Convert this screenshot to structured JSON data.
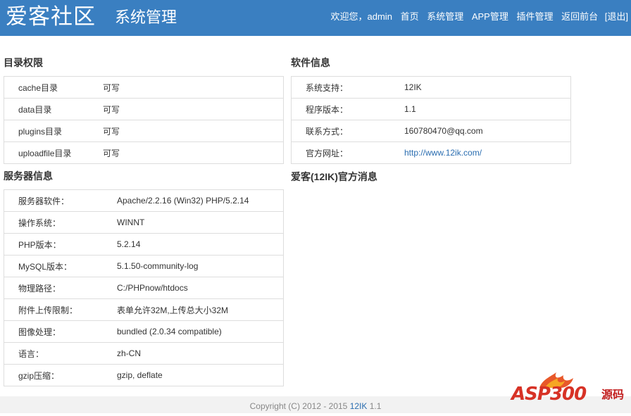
{
  "header": {
    "brand": "爱客社区",
    "subtitle": "系统管理",
    "welcome": "欢迎您，admin",
    "nav": [
      "首页",
      "系统管理",
      "APP管理",
      "插件管理",
      "返回前台",
      "[退出]"
    ]
  },
  "dir_perms": {
    "title": "目录权限",
    "rows": [
      {
        "k": "cache目录",
        "v": "可写"
      },
      {
        "k": "data目录",
        "v": "可写"
      },
      {
        "k": "plugins目录",
        "v": "可写"
      },
      {
        "k": "uploadfile目录",
        "v": "可写"
      }
    ]
  },
  "software": {
    "title": "软件信息",
    "rows": [
      {
        "k": "系统支持：",
        "v": "12IK"
      },
      {
        "k": "程序版本：",
        "v": "1.1"
      },
      {
        "k": "联系方式：",
        "v": "160780470@qq.com"
      },
      {
        "k": "官方网址：",
        "v": "http://www.12ik.com/"
      }
    ]
  },
  "server": {
    "title": "服务器信息",
    "rows": [
      {
        "k": "服务器软件：",
        "v": "Apache/2.2.16 (Win32) PHP/5.2.14"
      },
      {
        "k": "操作系统：",
        "v": "WINNT"
      },
      {
        "k": "PHP版本：",
        "v": "5.2.14"
      },
      {
        "k": "MySQL版本：",
        "v": "5.1.50-community-log"
      },
      {
        "k": "物理路径：",
        "v": "C:/PHPnow/htdocs"
      },
      {
        "k": "附件上传限制：",
        "v": "表单允许32M,上传总大小32M"
      },
      {
        "k": "图像处理：",
        "v": "bundled (2.0.34 compatible)"
      },
      {
        "k": "语言：",
        "v": "zh-CN"
      },
      {
        "k": "gzip压缩：",
        "v": "gzip, deflate"
      }
    ]
  },
  "news": {
    "title": "爱客(12IK)官方消息"
  },
  "footer": {
    "prefix": "Copyright (C) 2012 - 2015 ",
    "link": "12IK",
    "suffix": " 1.1"
  },
  "watermark": {
    "text": "ASP300",
    "cn": "源码"
  },
  "colors": {
    "header_bg": "#3a7fc1",
    "link": "#2a6db0",
    "border": "#dddddd"
  }
}
